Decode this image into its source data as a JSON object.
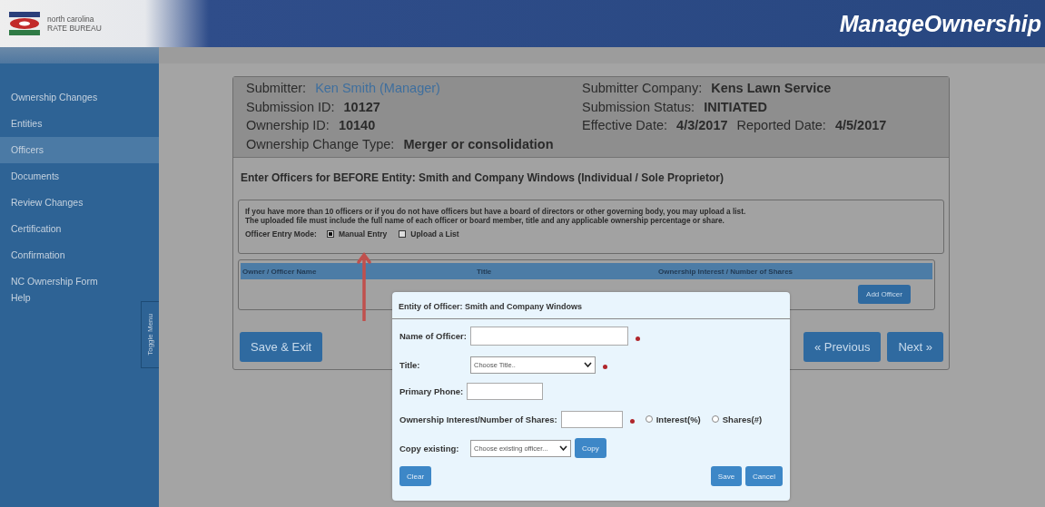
{
  "header": {
    "logo_lines": [
      "north carolina",
      "RATE BUREAU"
    ],
    "app_title": "ManageOwnership"
  },
  "sidebar": {
    "items": [
      {
        "label": "Ownership Changes",
        "selected": false
      },
      {
        "label": "Entities",
        "selected": false
      },
      {
        "label": "Officers",
        "selected": true
      },
      {
        "label": "Documents",
        "selected": false
      },
      {
        "label": "Review Changes",
        "selected": false
      },
      {
        "label": "Certification",
        "selected": false
      },
      {
        "label": "Confirmation",
        "selected": false
      },
      {
        "label": "NC Ownership Form",
        "selected": false
      },
      {
        "label": "Help",
        "selected": false
      }
    ],
    "toggle_label": "Toggle Menu"
  },
  "submission": {
    "left": [
      {
        "label": "Submitter:",
        "value": "Ken Smith (Manager)",
        "kind": "link"
      },
      {
        "label": "Submission ID:",
        "value": "10127",
        "kind": "bold"
      },
      {
        "label": "Ownership ID:",
        "value": "10140",
        "kind": "bold"
      },
      {
        "label": "Ownership Change Type:",
        "value": "Merger or consolidation",
        "kind": "bold"
      }
    ],
    "right": [
      [
        {
          "label": "Submitter Company:",
          "value": "Kens Lawn Service"
        }
      ],
      [
        {
          "label": "Submission Status:",
          "value": "INITIATED"
        }
      ],
      [
        {
          "label": "Effective Date:",
          "value": "4/3/2017"
        },
        {
          "label": "Reported Date:",
          "value": "4/5/2017"
        }
      ]
    ]
  },
  "section_heading": "Enter Officers for **BEFORE** Entity: Smith and Company Windows (Individual / Sole Proprietor)",
  "notice": {
    "lines": [
      "If you have more than 10 officers or if you do not have officers but have a board of directors or other governing body, you may upload a list.",
      "The uploaded file must include the full name of each officer or board member, title and any applicable ownership percentage or share."
    ],
    "mode_label": "Officer Entry Mode:",
    "options": [
      {
        "label": "Manual Entry",
        "selected": true
      },
      {
        "label": "Upload a List",
        "selected": false
      }
    ]
  },
  "officers_table": {
    "columns": [
      "Owner / Officer Name",
      "Title",
      "Ownership Interest / Number of Shares"
    ],
    "add_button": "Add Officer"
  },
  "nav_buttons": {
    "save_exit": "Save & Exit",
    "previous": "« Previous",
    "next": "Next »"
  },
  "dialog": {
    "title": "Entity of Officer: Smith and Company Windows",
    "name_label": "Name of Officer:",
    "name_required": true,
    "title_label": "Title:",
    "title_value": "Choose Title..",
    "title_required": true,
    "phone_label": "Primary Phone:",
    "interest_label": "Ownership Interest/Number of Shares:",
    "interest_required": true,
    "interest_options": [
      {
        "label": "Interest(%)",
        "selected": false
      },
      {
        "label": "Shares(#)",
        "selected": false
      }
    ],
    "copy_label": "Copy existing:",
    "copy_value": "Choose existing officer...",
    "copy_button": "Copy",
    "clear_button": "Clear",
    "save_button": "Save",
    "cancel_button": "Cancel"
  }
}
